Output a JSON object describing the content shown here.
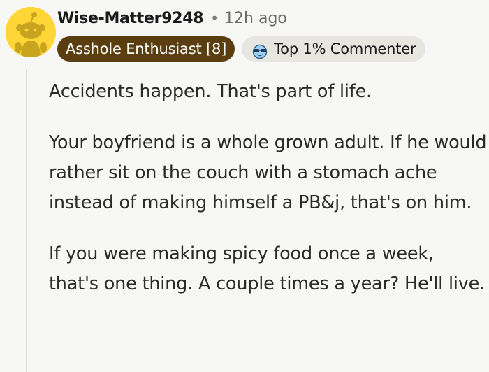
{
  "comment": {
    "username": "Wise-Matter9248",
    "separator": "•",
    "timestamp": "12h ago",
    "flair": "Asshole Enthusiast [8]",
    "badge": {
      "label": "Top 1% Commenter",
      "icon": "sunglasses-badge-icon"
    },
    "avatar": {
      "icon": "snoo-avatar-icon",
      "background_color": "#ffd635"
    },
    "paragraphs": [
      "Accidents happen. That's part of life.",
      "Your boyfriend is a whole grown adult. If he would rather sit on the couch with a stomach ache instead of making himself a PB&j, that's on him.",
      "If you were making spicy food once a week, that's one thing. A couple times a year? He'll live."
    ]
  }
}
